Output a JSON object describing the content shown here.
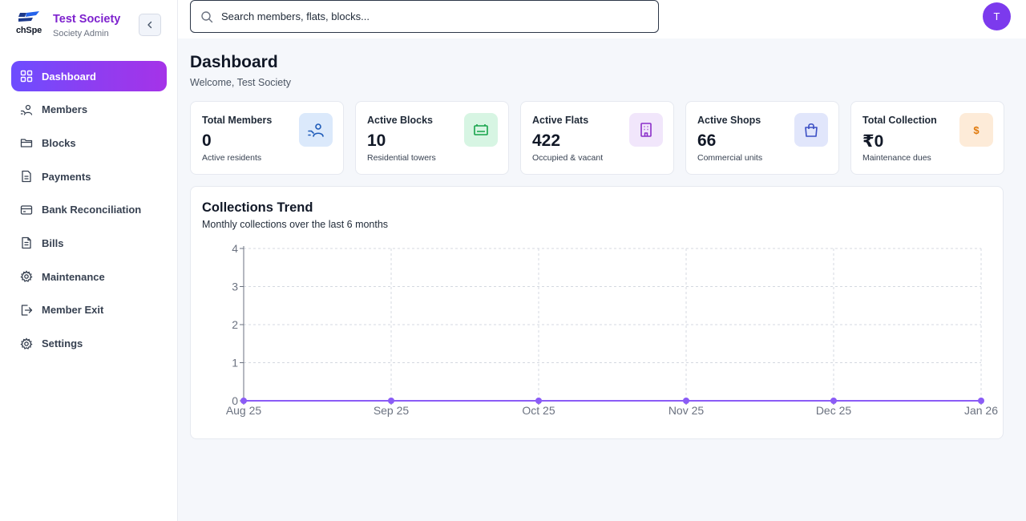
{
  "brand": {
    "logo_text": "chSpe",
    "name": "Test Society",
    "role": "Society Admin"
  },
  "sidebar": {
    "items": [
      {
        "label": "Dashboard",
        "icon": "grid-icon",
        "active": true
      },
      {
        "label": "Members",
        "icon": "members-icon",
        "active": false
      },
      {
        "label": "Blocks",
        "icon": "folder-icon",
        "active": false
      },
      {
        "label": "Payments",
        "icon": "document-icon",
        "active": false
      },
      {
        "label": "Bank Reconciliation",
        "icon": "credit-card-icon",
        "active": false
      },
      {
        "label": "Bills",
        "icon": "file-text-icon",
        "active": false
      },
      {
        "label": "Maintenance",
        "icon": "gear-icon",
        "active": false
      },
      {
        "label": "Member Exit",
        "icon": "log-out-icon",
        "active": false
      },
      {
        "label": "Settings",
        "icon": "settings-icon",
        "active": false
      }
    ]
  },
  "search": {
    "placeholder": "Search members, flats, blocks..."
  },
  "user": {
    "initial": "T"
  },
  "page": {
    "title": "Dashboard",
    "subtitle": "Welcome, Test Society"
  },
  "cards": [
    {
      "title": "Total Members",
      "value": "0",
      "sub": "Active residents",
      "icon": "members-icon",
      "bg": "#dbe9fb",
      "fg": "#1e5bb8"
    },
    {
      "title": "Active Blocks",
      "value": "10",
      "sub": "Residential towers",
      "icon": "tower-icon",
      "bg": "#d7f5e3",
      "fg": "#16a34a"
    },
    {
      "title": "Active Flats",
      "value": "422",
      "sub": "Occupied & vacant",
      "icon": "building-icon",
      "bg": "#f1e6fb",
      "fg": "#8b2fc9"
    },
    {
      "title": "Active Shops",
      "value": "66",
      "sub": "Commercial units",
      "icon": "shopping-bag-icon",
      "bg": "#e1e6fb",
      "fg": "#3b4fc4"
    },
    {
      "title": "Total Collection",
      "value": "₹0",
      "sub": "Maintenance dues",
      "icon": "dollar-icon",
      "icon_text": "$",
      "bg": "#fdebd8",
      "fg": "#e0790b"
    }
  ],
  "trend": {
    "title": "Collections Trend",
    "subtitle": "Monthly collections over the last 6 months"
  },
  "chart_data": {
    "type": "line",
    "categories": [
      "Aug 25",
      "Sep 25",
      "Oct 25",
      "Nov 25",
      "Dec 25",
      "Jan 26"
    ],
    "series": [
      {
        "values": [
          0,
          0,
          0,
          0,
          0,
          0
        ]
      }
    ],
    "yticks": [
      0,
      1,
      2,
      3,
      4
    ],
    "ylim": [
      0,
      4
    ],
    "grid": true,
    "color": "#8b5cf6"
  }
}
